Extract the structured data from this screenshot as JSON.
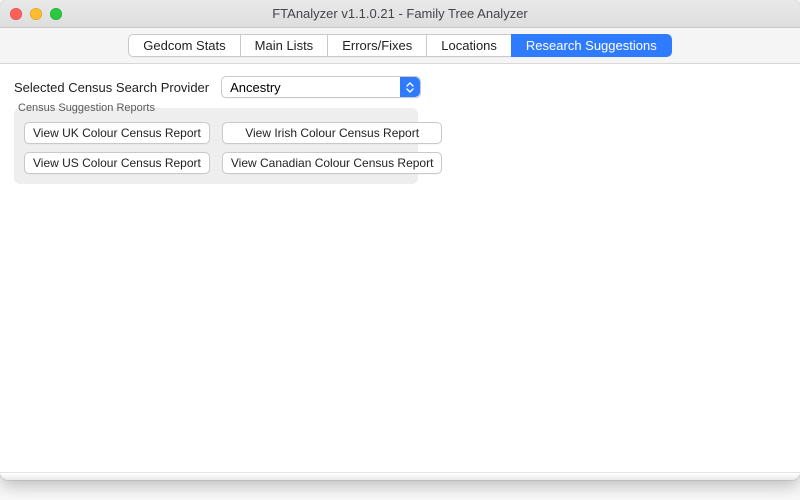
{
  "window": {
    "title": "FTAnalyzer v1.1.0.21 - Family Tree Analyzer"
  },
  "tabs": {
    "items": [
      {
        "label": "Gedcom Stats"
      },
      {
        "label": "Main Lists"
      },
      {
        "label": "Errors/Fixes"
      },
      {
        "label": "Locations"
      },
      {
        "label": "Research Suggestions"
      }
    ],
    "active_index": 4
  },
  "search_provider": {
    "label": "Selected Census Search Provider",
    "value": "Ancestry"
  },
  "group": {
    "title": "Census Suggestion Reports",
    "buttons": {
      "uk": "View UK Colour Census Report",
      "irish": "View Irish Colour Census Report",
      "us": "View US Colour Census Report",
      "canadian": "View Canadian Colour Census Report"
    }
  }
}
